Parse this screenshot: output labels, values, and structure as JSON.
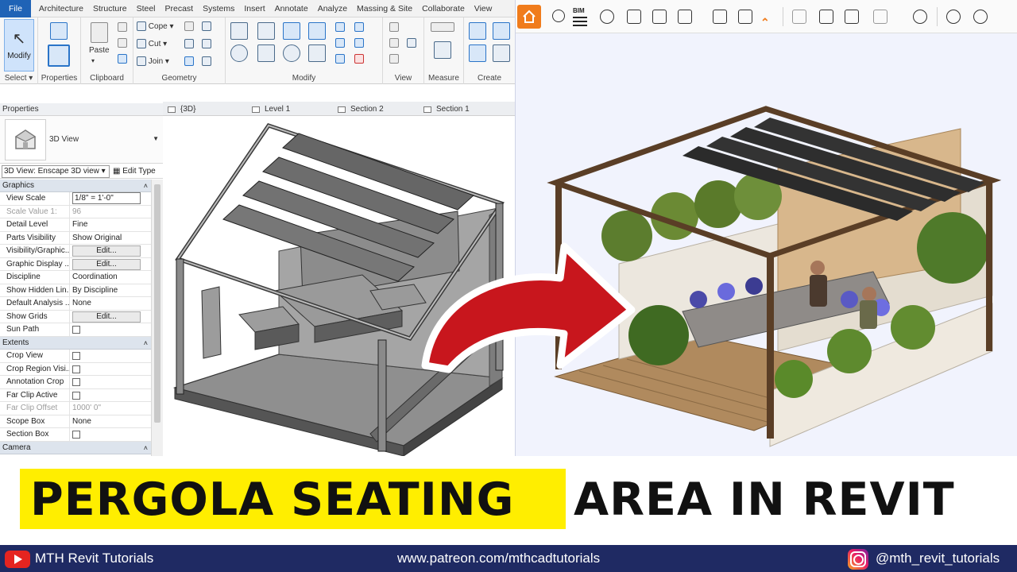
{
  "menu_bar": {
    "file": "File",
    "items": [
      "Architecture",
      "Structure",
      "Steel",
      "Precast",
      "Systems",
      "Insert",
      "Annotate",
      "Analyze",
      "Massing & Site",
      "Collaborate",
      "View"
    ]
  },
  "ribbon": {
    "modify_button": "Modify",
    "properties_button": "Properties",
    "paste_button": "Paste",
    "cope": "Cope",
    "cut": "Cut",
    "join": "Join",
    "groups": {
      "select": "Select",
      "properties": "Properties",
      "clipboard": "Clipboard",
      "geometry": "Geometry",
      "modify": "Modify",
      "view": "View",
      "measure": "Measure",
      "create": "Create"
    }
  },
  "properties": {
    "header": "Properties",
    "type_name": "3D View",
    "view_selector": "3D View: Enscape 3D view",
    "edit_type": "Edit Type",
    "sections": {
      "graphics": "Graphics",
      "extents": "Extents",
      "camera": "Camera"
    },
    "graphics_rows": [
      {
        "name": "View Scale",
        "value": "1/8\" = 1'-0\""
      },
      {
        "name": "Scale Value    1:",
        "value": "96"
      },
      {
        "name": "Detail Level",
        "value": "Fine"
      },
      {
        "name": "Parts Visibility",
        "value": "Show Original"
      },
      {
        "name": "Visibility/Graphic...",
        "value": "Edit..."
      },
      {
        "name": "Graphic Display ...",
        "value": "Edit..."
      },
      {
        "name": "Discipline",
        "value": "Coordination"
      },
      {
        "name": "Show Hidden Lin...",
        "value": "By Discipline"
      },
      {
        "name": "Default Analysis ...",
        "value": "None"
      },
      {
        "name": "Show Grids",
        "value": "Edit..."
      },
      {
        "name": "Sun Path",
        "value": ""
      }
    ],
    "extents_rows": [
      {
        "name": "Crop View",
        "value": ""
      },
      {
        "name": "Crop Region Visi...",
        "value": ""
      },
      {
        "name": "Annotation Crop",
        "value": ""
      },
      {
        "name": "Far Clip Active",
        "value": ""
      },
      {
        "name": "Far Clip Offset",
        "value": "1000'  0\""
      },
      {
        "name": "Scope Box",
        "value": "None"
      },
      {
        "name": "Section Box",
        "value": ""
      }
    ]
  },
  "view_tabs": [
    "{3D}",
    "Level 1",
    "Section 2",
    "Section 1"
  ],
  "enscape_toolbar": {
    "bim_label": "BIM",
    "icons": [
      "home-icon",
      "views-icon",
      "bim-icon",
      "binoculars-icon",
      "asset-icon",
      "buildings-icon",
      "clapper-icon",
      "export-icon",
      "batch-icon",
      "collapse-icon",
      "map-icon",
      "render-icon",
      "cube-icon",
      "atmosphere-icon",
      "vr-icon",
      "visibility-icon",
      "settings-icon"
    ],
    "accent": "#f07c1c"
  },
  "title": {
    "highlight": "PERGOLA SEATING",
    "rest": "AREA IN REVIT",
    "highlight_color": "#ffee00"
  },
  "footer": {
    "channel": "MTH Revit Tutorials",
    "website": "www.patreon.com/mthcadtutorials",
    "instagram": "@mth_revit_tutorials",
    "background": "#1f2a63"
  }
}
